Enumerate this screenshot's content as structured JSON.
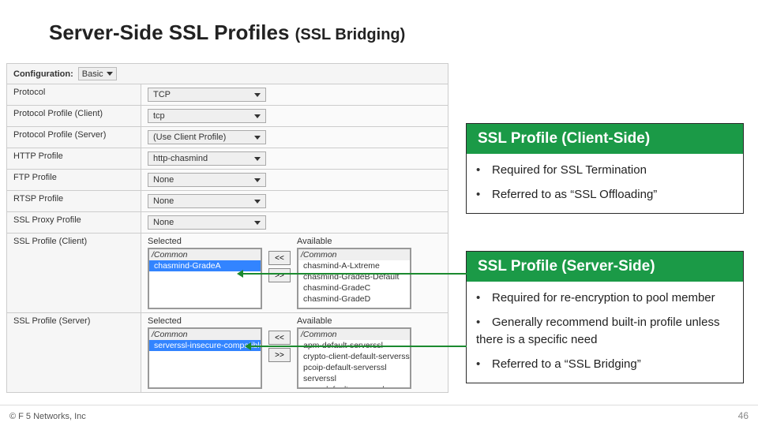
{
  "title_main": "Server-Side SSL Profiles",
  "title_sub": "(SSL Bridging)",
  "footer": "© F 5 Networks, Inc",
  "page_number": "46",
  "config": {
    "header_label": "Configuration:",
    "header_value": "Basic",
    "rows": [
      {
        "label": "Protocol",
        "value": "TCP"
      },
      {
        "label": "Protocol Profile (Client)",
        "value": "tcp"
      },
      {
        "label": "Protocol Profile (Server)",
        "value": "(Use Client Profile)"
      },
      {
        "label": "HTTP Profile",
        "value": "http-chasmind"
      },
      {
        "label": "FTP Profile",
        "value": "None"
      },
      {
        "label": "RTSP Profile",
        "value": "None"
      },
      {
        "label": "SSL Proxy Profile",
        "value": "None"
      }
    ],
    "client_ssl": {
      "row_label": "SSL Profile (Client)",
      "selected_title": "Selected",
      "available_title": "Available",
      "group": "/Common",
      "selected": [
        "chasmind-GradeA"
      ],
      "available": [
        "chasmind-A-Lxtreme",
        "chasmind-GradeB-Default",
        "chasmind-GradeC",
        "chasmind-GradeD"
      ]
    },
    "server_ssl": {
      "row_label": "SSL Profile (Server)",
      "selected_title": "Selected",
      "available_title": "Available",
      "group": "/Common",
      "selected": [
        "serverssl-insecure-compatible"
      ],
      "available": [
        "apm-default-serverssl",
        "crypto-client-default-serverss",
        "pcoip-default-serverssl",
        "serverssl",
        "wom-default-serverssl"
      ]
    }
  },
  "callout_client": {
    "heading": "SSL Profile (Client-Side)",
    "bullets": [
      "Required for SSL Termination",
      "Referred to as “SSL Offloading”"
    ]
  },
  "callout_server": {
    "heading": "SSL Profile (Server-Side)",
    "bullets": [
      "Required for re-encryption to pool member",
      "Generally recommend built-in profile unless there is a specific need",
      "Referred to a “SSL Bridging”"
    ]
  },
  "btn_left": "<<",
  "btn_right": ">>"
}
